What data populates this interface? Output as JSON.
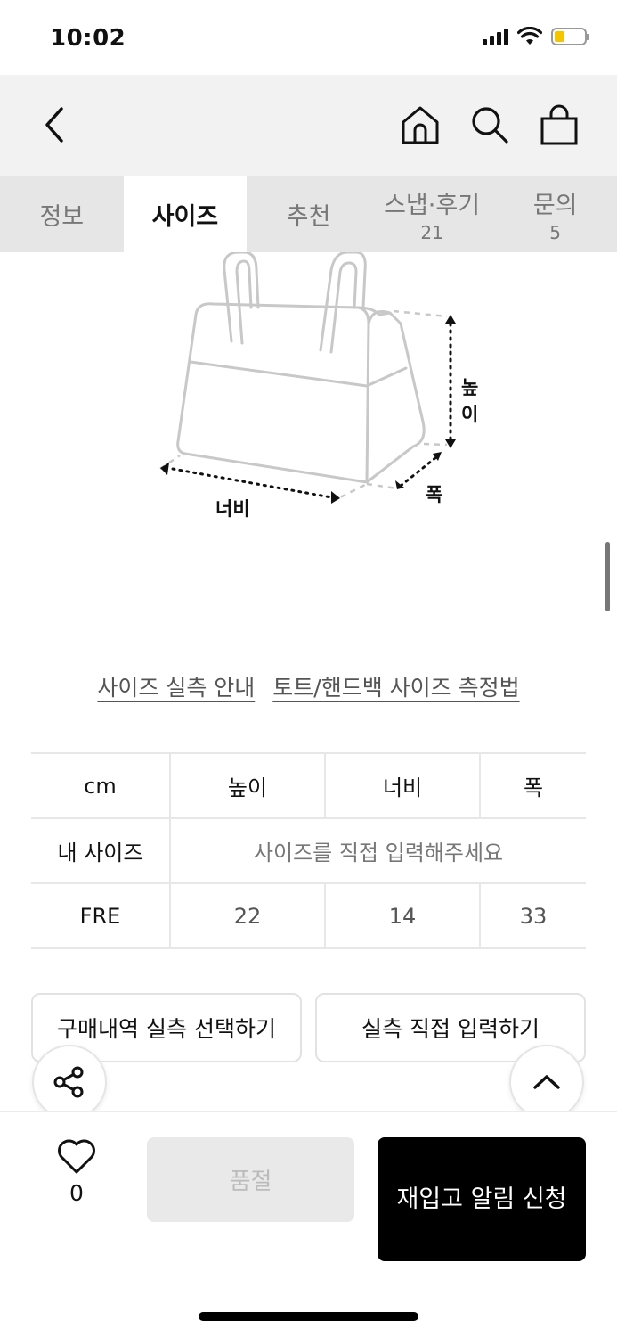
{
  "status_bar": {
    "time": "10:02",
    "battery_level": 0.35,
    "battery_color": "#f5c400"
  },
  "nav": {
    "icons": [
      "chevron-left-icon",
      "home-icon",
      "search-icon",
      "shopping-bag-icon"
    ]
  },
  "tabs": [
    {
      "label": "정보",
      "count": ""
    },
    {
      "label": "사이즈",
      "count": "",
      "active": true
    },
    {
      "label": "추천",
      "count": ""
    },
    {
      "label": "스냅·후기",
      "count": "21"
    },
    {
      "label": "문의",
      "count": "5"
    }
  ],
  "diagram": {
    "height_label": "높이",
    "width_label": "너비",
    "depth_label": "폭"
  },
  "links": {
    "guide": "사이즈 실측 안내",
    "method": "토트/핸드백 사이즈 측정법"
  },
  "size_table": {
    "unit": "cm",
    "headers": [
      "높이",
      "너비",
      "폭"
    ],
    "my_size_label": "내 사이즈",
    "my_size_prompt": "사이즈를 직접 입력해주세요",
    "rows": [
      {
        "size": "FRE",
        "values": [
          "22",
          "14",
          "33"
        ]
      }
    ]
  },
  "actions": {
    "select_from_history": "구매내역 실측 선택하기",
    "direct_input": "실측 직접 입력하기"
  },
  "bottom_bar": {
    "like_count": "0",
    "soldout_label": "품절",
    "restock_label": "재입고 알림 신청"
  },
  "colors": {
    "accent": "#000000",
    "tab_bg": "#e6e6e6",
    "nav_bg": "#f2f2f2"
  }
}
